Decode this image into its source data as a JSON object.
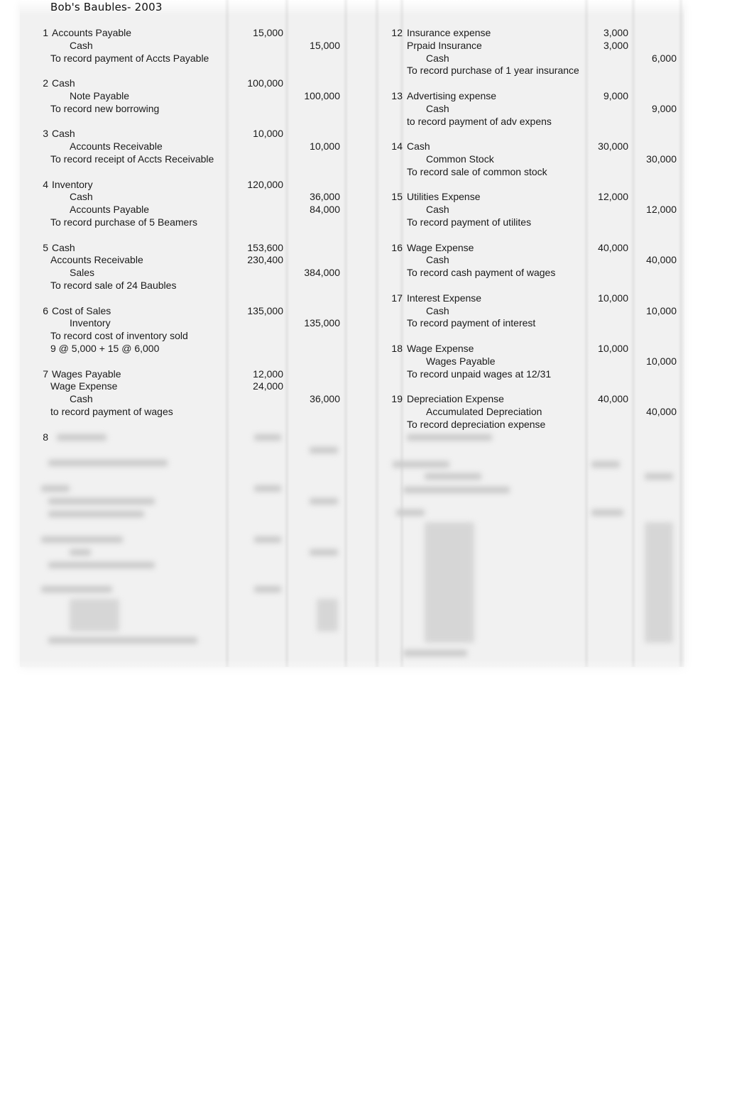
{
  "document": {
    "title": "Bob's Baubles- 2003"
  },
  "left_entries": [
    {
      "number": "1",
      "lines": [
        {
          "text": "Accounts Payable",
          "debit": "15,000",
          "credit": ""
        },
        {
          "text": "Cash",
          "debit": "",
          "credit": "15,000",
          "indent": "credit"
        },
        {
          "text": "To record payment of Accts Payable",
          "debit": "",
          "credit": "",
          "indent": "memo"
        }
      ]
    },
    {
      "number": "2",
      "lines": [
        {
          "text": "Cash",
          "debit": "100,000",
          "credit": ""
        },
        {
          "text": "Note Payable",
          "debit": "",
          "credit": "100,000",
          "indent": "credit"
        },
        {
          "text": "To record new borrowing",
          "debit": "",
          "credit": "",
          "indent": "memo"
        }
      ]
    },
    {
      "number": "3",
      "lines": [
        {
          "text": "Cash",
          "debit": "10,000",
          "credit": ""
        },
        {
          "text": "Accounts Receivable",
          "debit": "",
          "credit": "10,000",
          "indent": "credit"
        },
        {
          "text": "To record receipt of Accts Receivable",
          "debit": "",
          "credit": "",
          "indent": "memo"
        }
      ]
    },
    {
      "number": "4",
      "lines": [
        {
          "text": "Inventory",
          "debit": "120,000",
          "credit": ""
        },
        {
          "text": "Cash",
          "debit": "",
          "credit": "36,000",
          "indent": "credit"
        },
        {
          "text": "Accounts Payable",
          "debit": "",
          "credit": "84,000",
          "indent": "credit"
        },
        {
          "text": "To record purchase of 5 Beamers",
          "debit": "",
          "credit": "",
          "indent": "memo"
        }
      ]
    },
    {
      "number": "5",
      "lines": [
        {
          "text": "Cash",
          "debit": "153,600",
          "credit": ""
        },
        {
          "text": "Accounts Receivable",
          "debit": "230,400",
          "credit": "",
          "indent": "memo"
        },
        {
          "text": "Sales",
          "debit": "",
          "credit": "384,000",
          "indent": "credit"
        },
        {
          "text": "To record sale of 24 Baubles",
          "debit": "",
          "credit": "",
          "indent": "memo"
        }
      ]
    },
    {
      "number": "6",
      "lines": [
        {
          "text": "Cost of Sales",
          "debit": "135,000",
          "credit": ""
        },
        {
          "text": "Inventory",
          "debit": "",
          "credit": "135,000",
          "indent": "credit"
        },
        {
          "text": "To record cost of inventory sold",
          "debit": "",
          "credit": "",
          "indent": "memo"
        },
        {
          "text": "9 @ 5,000 + 15 @ 6,000",
          "debit": "",
          "credit": "",
          "indent": "memo"
        }
      ]
    },
    {
      "number": "7",
      "lines": [
        {
          "text": "Wages Payable",
          "debit": "12,000",
          "credit": ""
        },
        {
          "text": "Wage Expense",
          "debit": "24,000",
          "credit": "",
          "indent": "memo"
        },
        {
          "text": "Cash",
          "debit": "",
          "credit": "36,000",
          "indent": "credit"
        },
        {
          "text": "to record payment of wages",
          "debit": "",
          "credit": "",
          "indent": "memo"
        }
      ]
    },
    {
      "number": "8",
      "lines": []
    }
  ],
  "right_entries": [
    {
      "number": "12",
      "lines": [
        {
          "text": "Insurance expense",
          "debit": "3,000",
          "credit": ""
        },
        {
          "text": "Prpaid Insurance",
          "debit": "3,000",
          "credit": "",
          "indent": "memo"
        },
        {
          "text": "Cash",
          "debit": "",
          "credit": "6,000",
          "indent": "credit"
        },
        {
          "text": "To record purchase of 1 year insurance",
          "debit": "",
          "credit": "",
          "indent": "memo"
        }
      ]
    },
    {
      "number": "13",
      "lines": [
        {
          "text": "Advertising expense",
          "debit": "9,000",
          "credit": ""
        },
        {
          "text": "Cash",
          "debit": "",
          "credit": "9,000",
          "indent": "credit"
        },
        {
          "text": "to record payment of adv expens",
          "debit": "",
          "credit": "",
          "indent": "memo"
        }
      ]
    },
    {
      "number": "14",
      "lines": [
        {
          "text": "Cash",
          "debit": "30,000",
          "credit": ""
        },
        {
          "text": "Common Stock",
          "debit": "",
          "credit": "30,000",
          "indent": "credit"
        },
        {
          "text": "To record sale of common stock",
          "debit": "",
          "credit": "",
          "indent": "memo"
        }
      ]
    },
    {
      "number": "15",
      "lines": [
        {
          "text": "Utilities Expense",
          "debit": "12,000",
          "credit": ""
        },
        {
          "text": "Cash",
          "debit": "",
          "credit": "12,000",
          "indent": "credit"
        },
        {
          "text": "To record payment of utilites",
          "debit": "",
          "credit": "",
          "indent": "memo"
        }
      ]
    },
    {
      "number": "16",
      "lines": [
        {
          "text": "Wage Expense",
          "debit": "40,000",
          "credit": ""
        },
        {
          "text": "Cash",
          "debit": "",
          "credit": "40,000",
          "indent": "credit"
        },
        {
          "text": "To record cash payment of wages",
          "debit": "",
          "credit": "",
          "indent": "memo"
        }
      ]
    },
    {
      "number": "17",
      "lines": [
        {
          "text": "Interest Expense",
          "debit": "10,000",
          "credit": ""
        },
        {
          "text": "Cash",
          "debit": "",
          "credit": "10,000",
          "indent": "credit"
        },
        {
          "text": "To record payment of interest",
          "debit": "",
          "credit": "",
          "indent": "memo"
        }
      ]
    },
    {
      "number": "18",
      "lines": [
        {
          "text": "Wage Expense",
          "debit": "10,000",
          "credit": ""
        },
        {
          "text": "Wages Payable",
          "debit": "",
          "credit": "10,000",
          "indent": "credit"
        },
        {
          "text": "To record unpaid wages at 12/31",
          "debit": "",
          "credit": "",
          "indent": "memo"
        }
      ]
    },
    {
      "number": "19",
      "lines": [
        {
          "text": "Depreciation Expense",
          "debit": "40,000",
          "credit": ""
        },
        {
          "text": "Accumulated Depreciation",
          "debit": "",
          "credit": "40,000",
          "indent": "credit"
        },
        {
          "text": "To record depreciation expense",
          "debit": "",
          "credit": "",
          "indent": "memo"
        }
      ]
    }
  ],
  "colors": {
    "sheet_background": "#f1f1f1",
    "text": "#1a1a1a",
    "blurred_text": "#c8c8c8"
  }
}
